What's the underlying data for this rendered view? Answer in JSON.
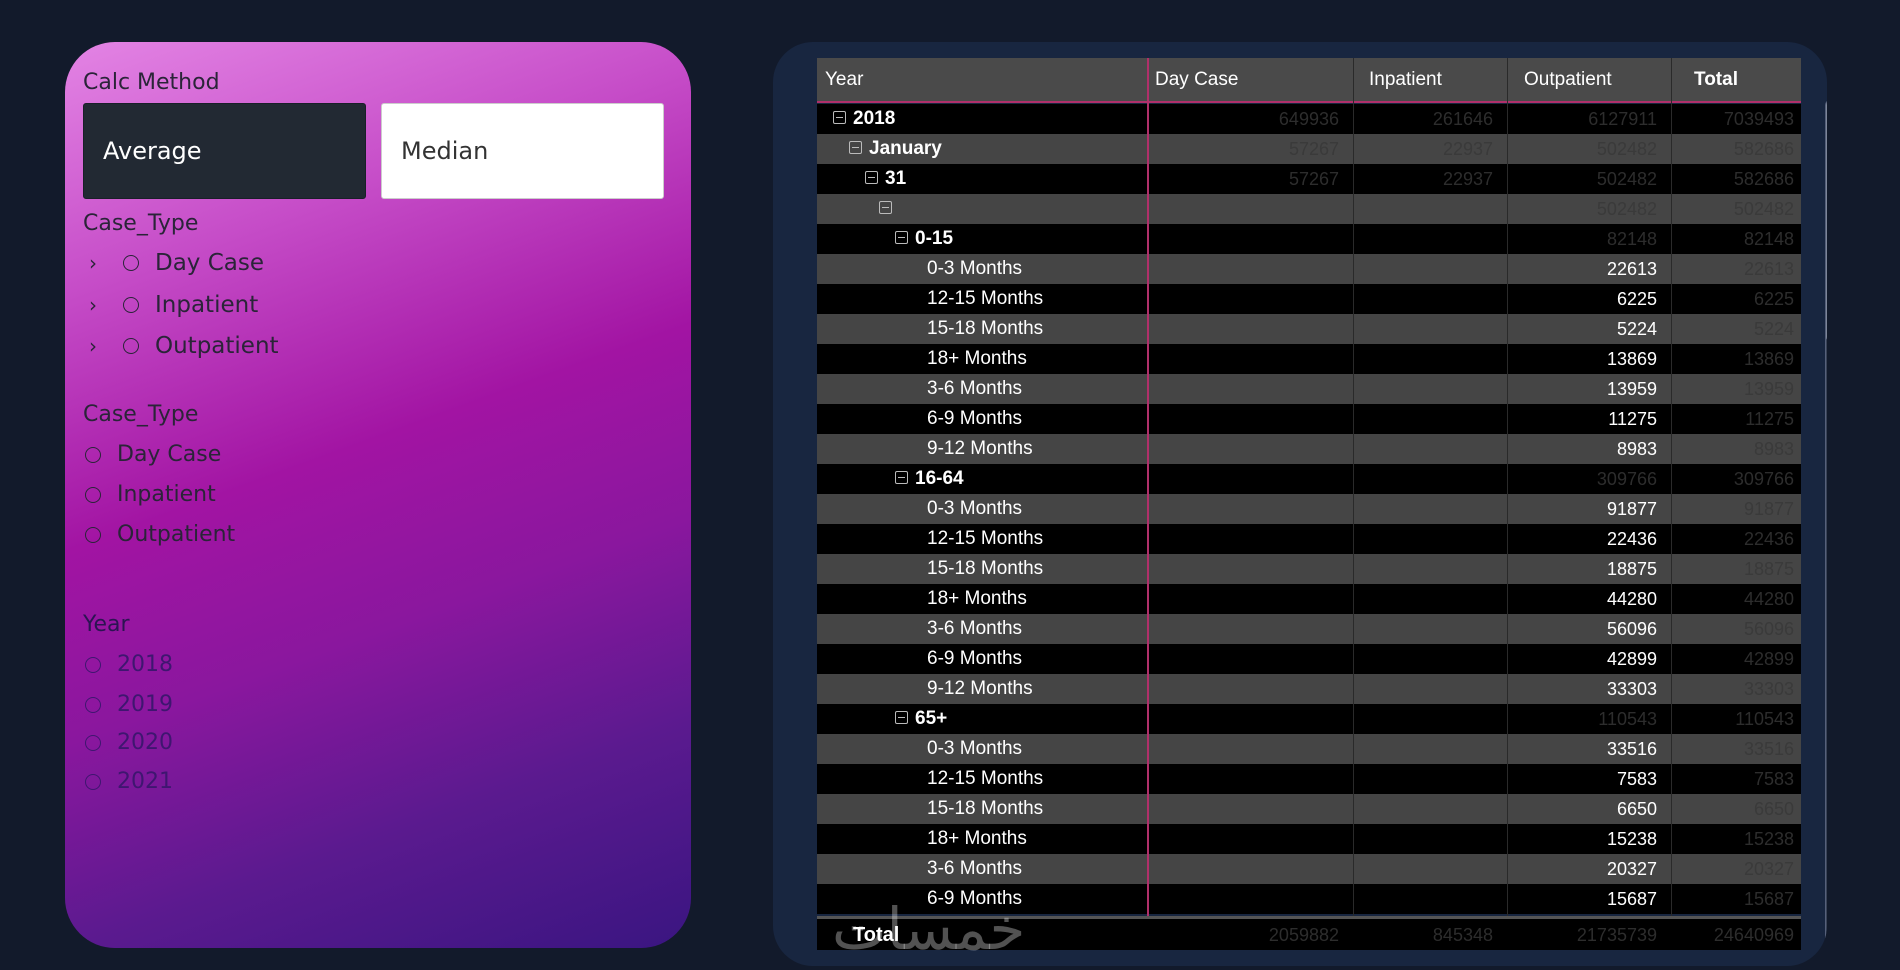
{
  "left_panel": {
    "calc_method": {
      "label": "Calc Method",
      "options": [
        "Average",
        "Median"
      ],
      "selected": "Average"
    },
    "case_type_tree": {
      "label": "Case_Type",
      "items": [
        "Day Case",
        "Inpatient",
        "Outpatient"
      ]
    },
    "case_type_list": {
      "label": "Case_Type",
      "items": [
        "Day Case",
        "Inpatient",
        "Outpatient"
      ]
    },
    "year": {
      "label": "Year",
      "items": [
        "2018",
        "2019",
        "2020",
        "2021"
      ]
    }
  },
  "table": {
    "columns": [
      "Year",
      "Day Case",
      "Inpatient",
      "Outpatient",
      "Total"
    ],
    "rows": [
      {
        "level": 0,
        "label": "2018",
        "kind": "group",
        "values": [
          "649936",
          "261646",
          "6127911",
          "7039493"
        ]
      },
      {
        "level": 1,
        "label": "January",
        "kind": "group",
        "values": [
          "57267",
          "22937",
          "502482",
          "582686"
        ]
      },
      {
        "level": 2,
        "label": "31",
        "kind": "group",
        "values": [
          "57267",
          "22937",
          "502482",
          "582686"
        ]
      },
      {
        "level": 3,
        "label": "",
        "kind": "group",
        "values": [
          "",
          "",
          "502482",
          "502482"
        ]
      },
      {
        "level": 4,
        "label": "0-15",
        "kind": "group",
        "values": [
          "",
          "",
          "82148",
          "82148"
        ]
      },
      {
        "level": 5,
        "label": "0-3 Months",
        "kind": "leaf",
        "values": [
          "",
          "",
          "22613",
          "22613"
        ]
      },
      {
        "level": 5,
        "label": "12-15 Months",
        "kind": "leaf",
        "values": [
          "",
          "",
          "6225",
          "6225"
        ]
      },
      {
        "level": 5,
        "label": "15-18 Months",
        "kind": "leaf",
        "values": [
          "",
          "",
          "5224",
          "5224"
        ]
      },
      {
        "level": 5,
        "label": "18+ Months",
        "kind": "leaf",
        "values": [
          "",
          "",
          "13869",
          "13869"
        ]
      },
      {
        "level": 5,
        "label": "3-6 Months",
        "kind": "leaf",
        "values": [
          "",
          "",
          "13959",
          "13959"
        ]
      },
      {
        "level": 5,
        "label": "6-9 Months",
        "kind": "leaf",
        "values": [
          "",
          "",
          "11275",
          "11275"
        ]
      },
      {
        "level": 5,
        "label": "9-12 Months",
        "kind": "leaf",
        "values": [
          "",
          "",
          "8983",
          "8983"
        ]
      },
      {
        "level": 4,
        "label": "16-64",
        "kind": "group",
        "values": [
          "",
          "",
          "309766",
          "309766"
        ]
      },
      {
        "level": 5,
        "label": "0-3 Months",
        "kind": "leaf",
        "values": [
          "",
          "",
          "91877",
          "91877"
        ]
      },
      {
        "level": 5,
        "label": "12-15 Months",
        "kind": "leaf",
        "values": [
          "",
          "",
          "22436",
          "22436"
        ]
      },
      {
        "level": 5,
        "label": "15-18 Months",
        "kind": "leaf",
        "values": [
          "",
          "",
          "18875",
          "18875"
        ]
      },
      {
        "level": 5,
        "label": "18+ Months",
        "kind": "leaf",
        "values": [
          "",
          "",
          "44280",
          "44280"
        ]
      },
      {
        "level": 5,
        "label": "3-6 Months",
        "kind": "leaf",
        "values": [
          "",
          "",
          "56096",
          "56096"
        ]
      },
      {
        "level": 5,
        "label": "6-9 Months",
        "kind": "leaf",
        "values": [
          "",
          "",
          "42899",
          "42899"
        ]
      },
      {
        "level": 5,
        "label": "9-12 Months",
        "kind": "leaf",
        "values": [
          "",
          "",
          "33303",
          "33303"
        ]
      },
      {
        "level": 4,
        "label": "65+",
        "kind": "group",
        "values": [
          "",
          "",
          "110543",
          "110543"
        ]
      },
      {
        "level": 5,
        "label": "0-3 Months",
        "kind": "leaf",
        "values": [
          "",
          "",
          "33516",
          "33516"
        ]
      },
      {
        "level": 5,
        "label": "12-15 Months",
        "kind": "leaf",
        "values": [
          "",
          "",
          "7583",
          "7583"
        ]
      },
      {
        "level": 5,
        "label": "15-18 Months",
        "kind": "leaf",
        "values": [
          "",
          "",
          "6650",
          "6650"
        ]
      },
      {
        "level": 5,
        "label": "18+ Months",
        "kind": "leaf",
        "values": [
          "",
          "",
          "15238",
          "15238"
        ]
      },
      {
        "level": 5,
        "label": "3-6 Months",
        "kind": "leaf",
        "values": [
          "",
          "",
          "20327",
          "20327"
        ]
      },
      {
        "level": 5,
        "label": "6-9 Months",
        "kind": "leaf",
        "values": [
          "",
          "",
          "15687",
          "15687"
        ]
      }
    ],
    "total": {
      "label": "Total",
      "values": [
        "2059882",
        "845348",
        "21735739",
        "24640969"
      ]
    }
  },
  "watermark": "خمسات",
  "colors": {
    "accent_divider": "#b0306a",
    "card_background": "#182640",
    "page_background": "#121a2b"
  }
}
